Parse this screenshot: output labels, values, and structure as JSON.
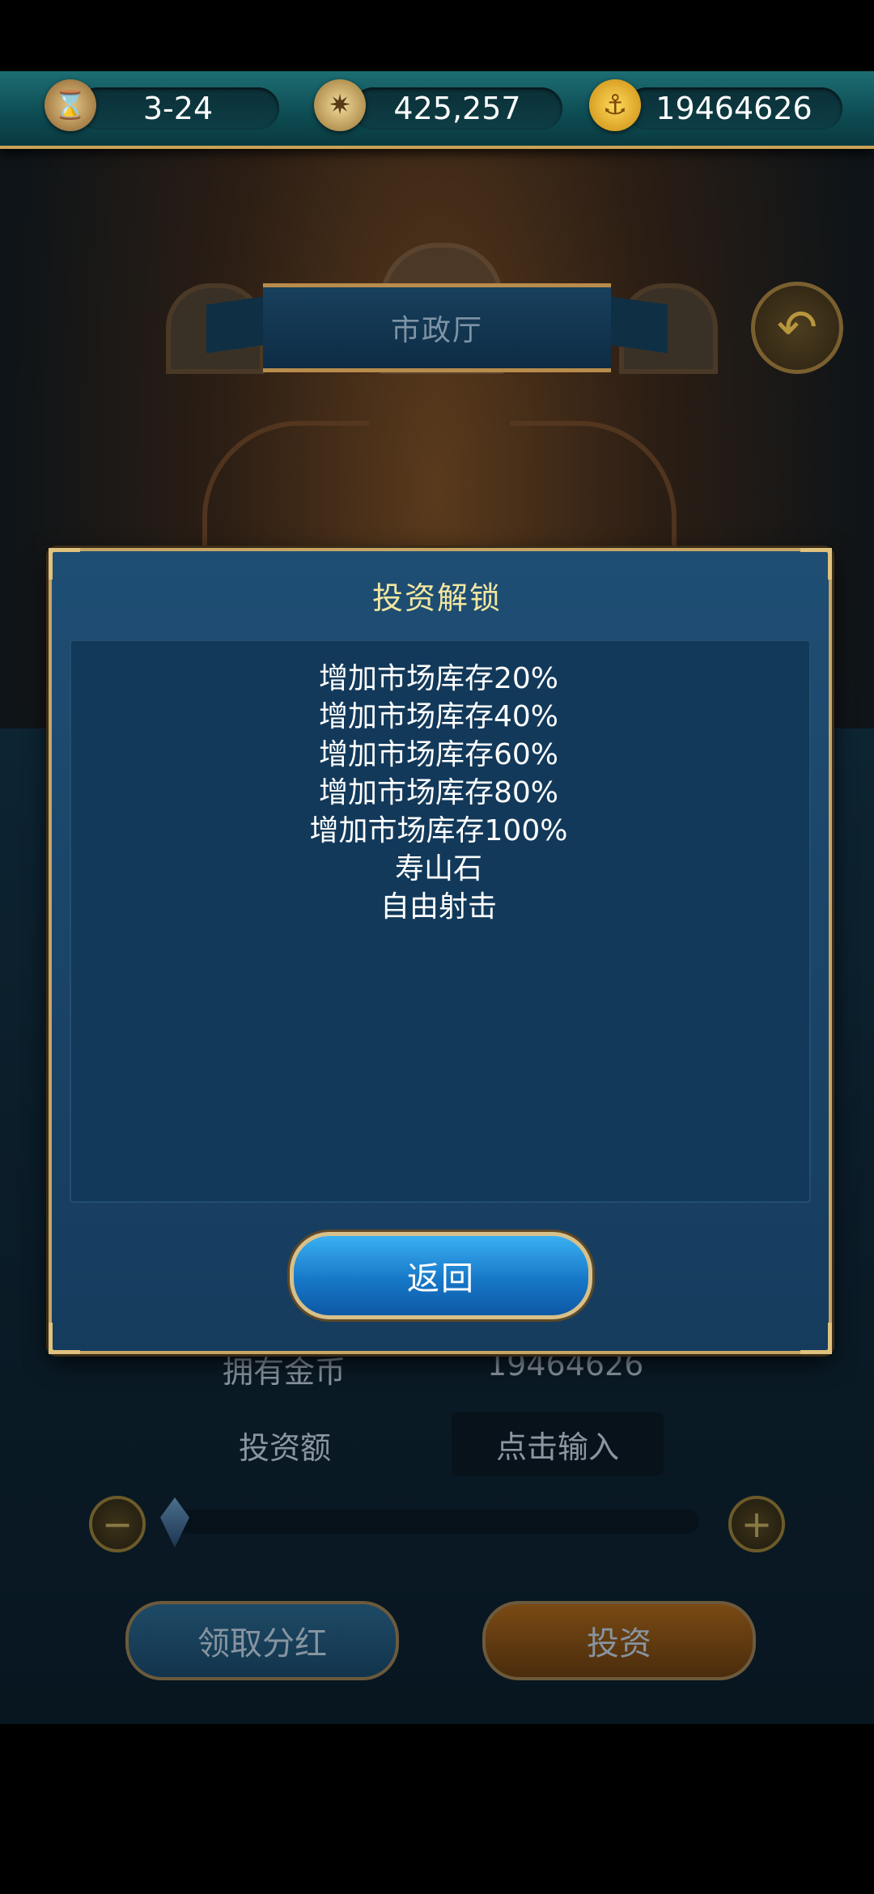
{
  "topbar": {
    "date": "3-24",
    "compass_value": "425,257",
    "gold": "19464626",
    "icons": [
      "hourglass-icon",
      "compass-icon",
      "anchor-coin-icon"
    ]
  },
  "header": {
    "title": "市政厅",
    "back_icon": "return-arrow-icon"
  },
  "background_panel": {
    "owned_gold_label": "拥有金币",
    "owned_gold_value": "19464626",
    "invest_amount_label": "投资额",
    "invest_input_placeholder": "点击输入",
    "slider_level": 0,
    "minus_icon": "minus-icon",
    "plus_icon": "plus-icon",
    "dividend_button": "领取分红",
    "invest_button": "投资"
  },
  "modal": {
    "title": "投资解锁",
    "items": [
      "增加市场库存20%",
      "增加市场库存40%",
      "增加市场库存60%",
      "增加市场库存80%",
      "增加市场库存100%",
      "寿山石",
      "自由射击"
    ],
    "back_button": "返回"
  },
  "colors": {
    "modal_title": "#f2e7a0",
    "gold_border": "#c7a565",
    "primary_button": "#1778c8"
  }
}
